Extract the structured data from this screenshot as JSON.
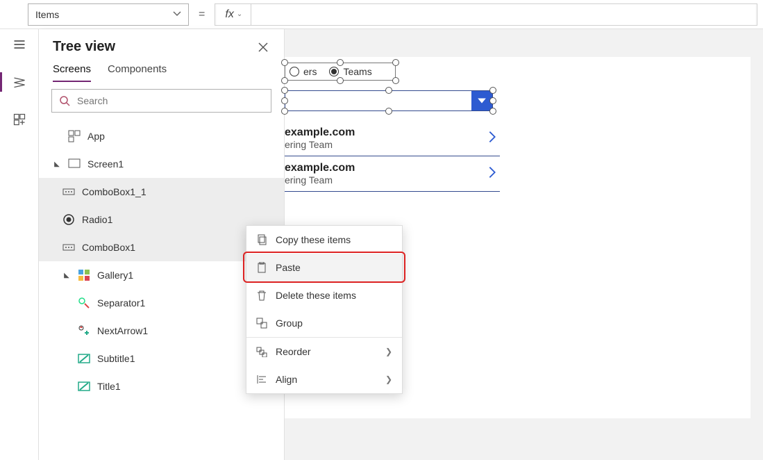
{
  "formula": {
    "property": "Items",
    "equals": "=",
    "fx": "fx",
    "value": ""
  },
  "tree": {
    "title": "Tree view",
    "tab_screens": "Screens",
    "tab_components": "Components",
    "search_placeholder": "Search",
    "items": {
      "app": "App",
      "screen1": "Screen1",
      "combobox1_1": "ComboBox1_1",
      "radio1": "Radio1",
      "combobox1": "ComboBox1",
      "gallery1": "Gallery1",
      "separator1": "Separator1",
      "nextarrow1": "NextArrow1",
      "subtitle1": "Subtitle1",
      "title1": "Title1"
    }
  },
  "canvas": {
    "radio": {
      "opt1": "ers",
      "opt2": "Teams"
    },
    "rows": [
      {
        "title": "example.com",
        "subtitle": "ering Team"
      },
      {
        "title": "example.com",
        "subtitle": "ering Team"
      }
    ]
  },
  "menu": {
    "copy": "Copy these items",
    "paste": "Paste",
    "delete": "Delete these items",
    "group": "Group",
    "reorder": "Reorder",
    "align": "Align"
  }
}
